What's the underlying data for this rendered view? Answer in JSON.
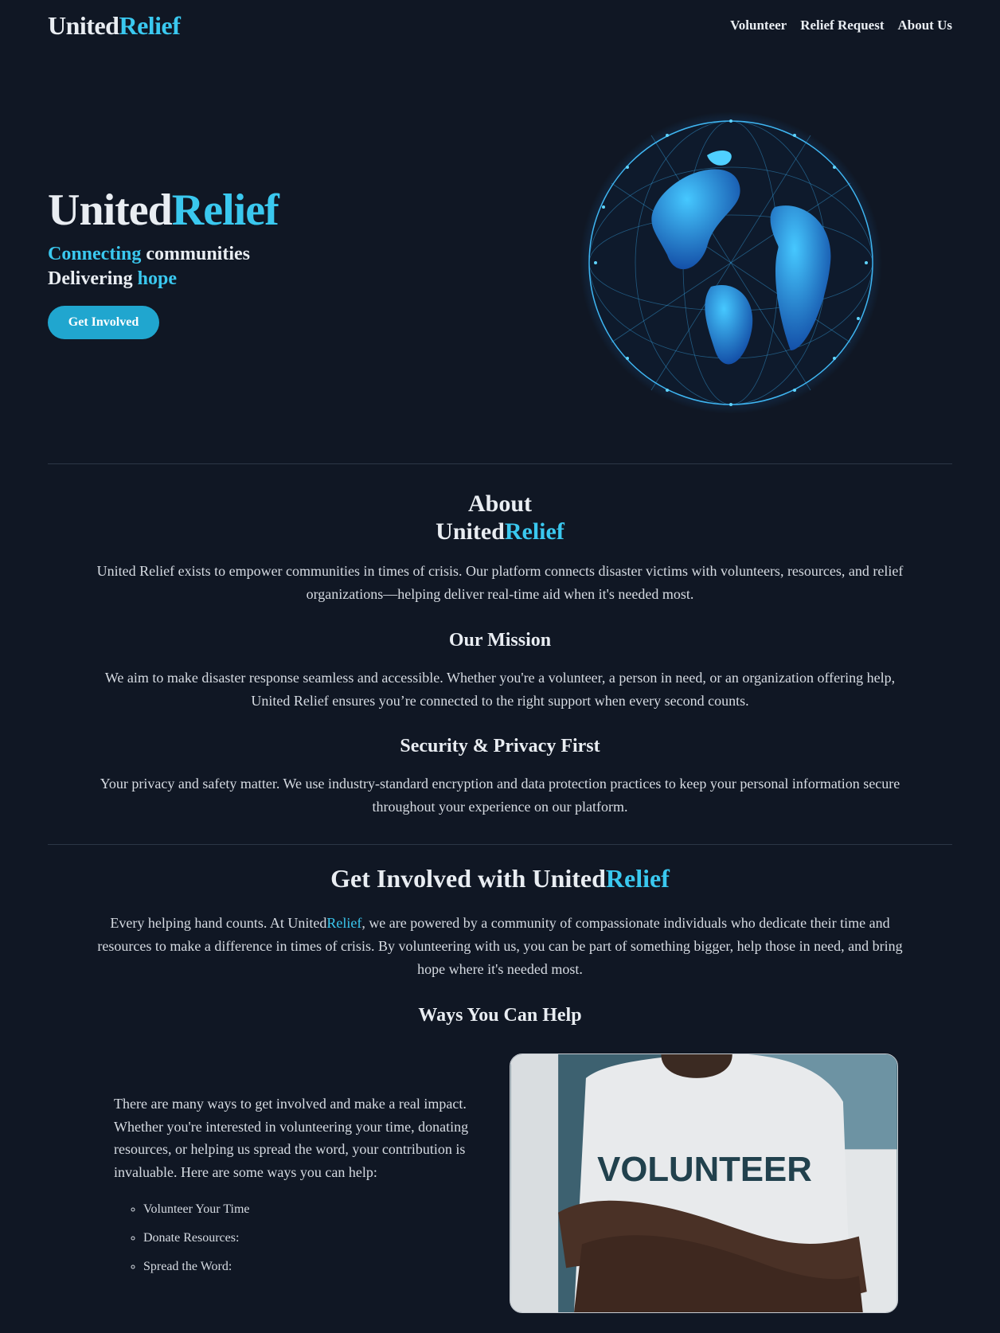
{
  "brand": {
    "part1": "United",
    "part2": "Relief"
  },
  "nav": {
    "links": [
      "Volunteer",
      "Relief Request",
      "About Us"
    ]
  },
  "hero": {
    "title_part1": "United",
    "title_part2": "Relief",
    "line1_accent": "Connecting",
    "line1_rest": " communities",
    "line2_start": "Delivering ",
    "line2_accent": "hope",
    "cta": "Get Involved"
  },
  "about": {
    "heading_line1": "About",
    "heading_part1": "United",
    "heading_part2": "Relief",
    "body": "United Relief exists to empower communities in times of crisis. Our platform connects disaster victims with volunteers, resources, and relief organizations—helping deliver real-time aid when it's needed most.",
    "mission_heading": "Our Mission",
    "mission_body": "We aim to make disaster response seamless and accessible. Whether you're a volunteer, a person in need, or an organization offering help, United Relief ensures you’re connected to the right support when every second counts.",
    "security_heading": "Security & Privacy First",
    "security_body": "Your privacy and safety matter. We use industry-standard encryption and data protection practices to keep your personal information secure throughout your experience on our platform."
  },
  "involved": {
    "heading_prefix": "Get Involved with United",
    "heading_accent": "Relief",
    "body_prefix": "Every helping hand counts. At United",
    "body_accent": "Relief",
    "body_suffix": ", we are powered by a community of compassionate individuals who dedicate their time and resources to make a difference in times of crisis. By volunteering with us, you can be part of something bigger, help those in need, and bring hope where it's needed most.",
    "ways_heading": "Ways You Can Help",
    "ways_body": "There are many ways to get involved and make a real impact. Whether you're interested in volunteering your time, donating resources, or helping us spread the word, your contribution is invaluable. Here are some ways you can help:",
    "ways_list": [
      "Volunteer Your Time",
      "Donate Resources:",
      "Spread the Word:"
    ],
    "photo_shirt_text": "VOLUNTEER"
  },
  "colors": {
    "accent": "#3ac8ef",
    "background": "#101724",
    "button": "#20a6cf"
  }
}
